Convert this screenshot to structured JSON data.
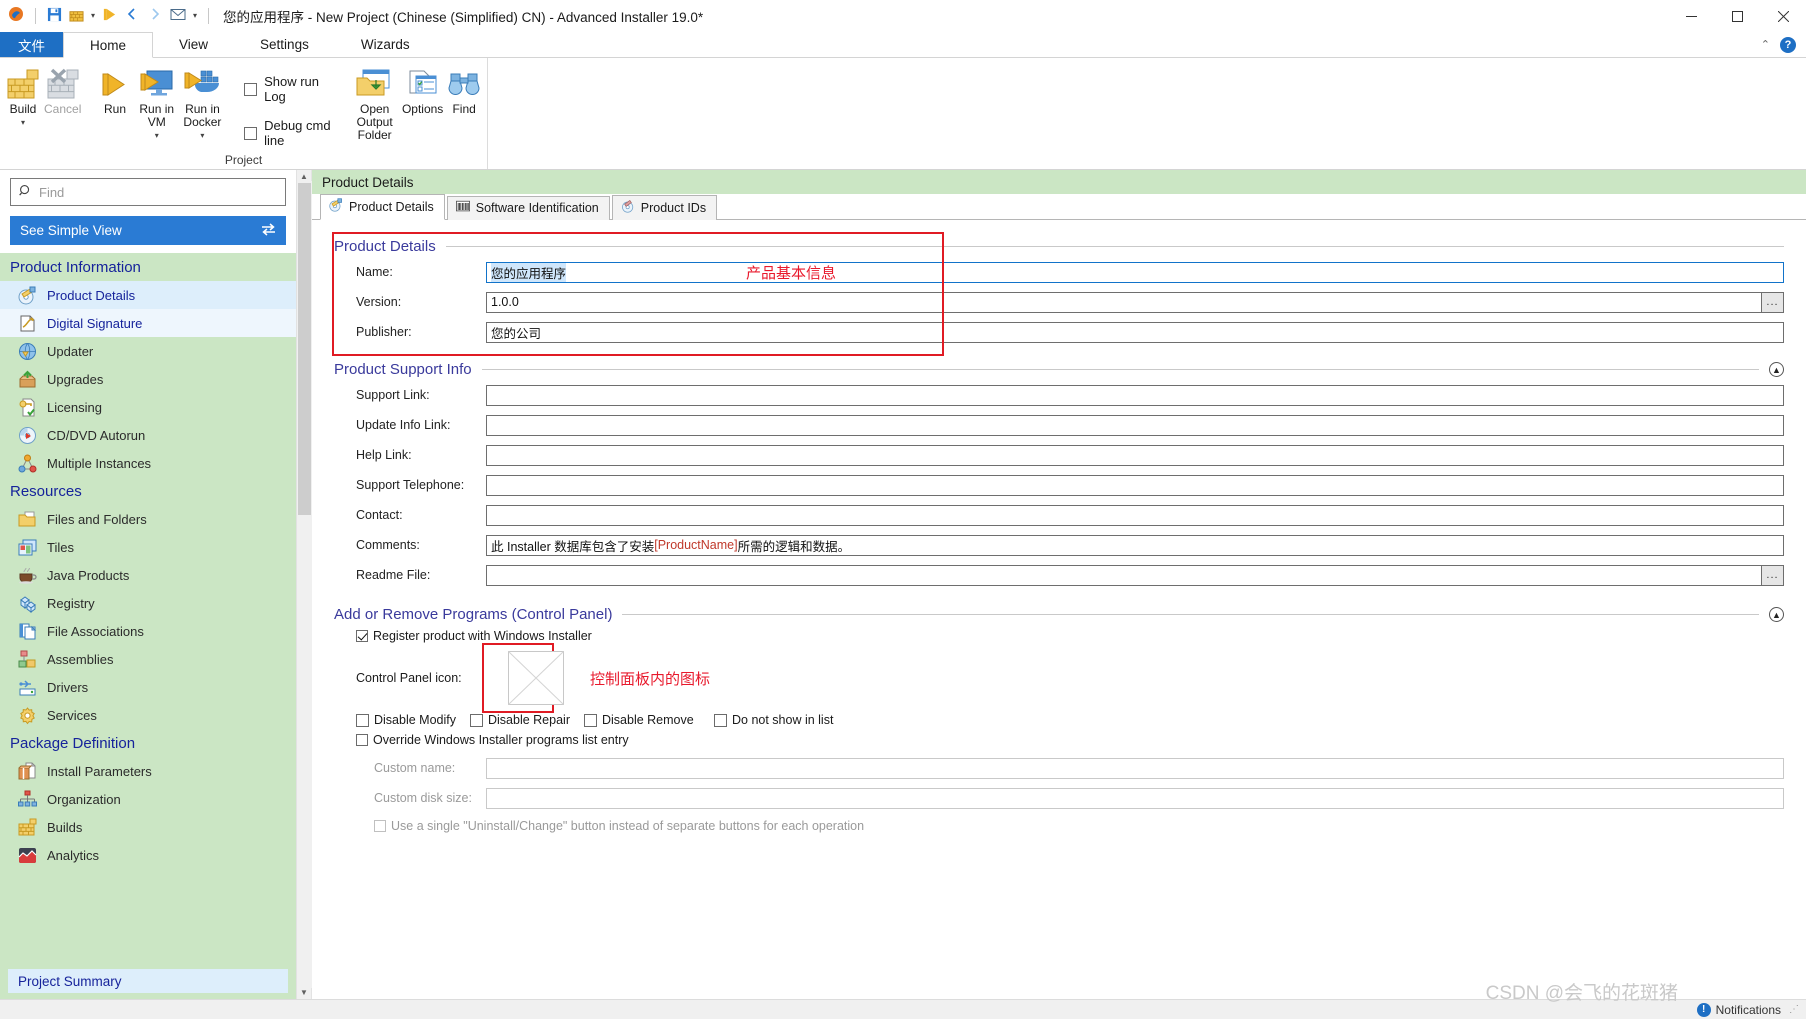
{
  "window": {
    "title": "您的应用程序 - New Project (Chinese (Simplified) CN) - Advanced Installer 19.0*",
    "minimize": "—",
    "maximize": "☐",
    "close": "✕",
    "quick_access": [
      "app-icon",
      "save-icon",
      "build-icon",
      "run-icon",
      "back-icon",
      "forward-icon",
      "mail-icon",
      "qat-dropdown-icon"
    ]
  },
  "ribbon": {
    "tabs": [
      {
        "label": "文件",
        "type": "file"
      },
      {
        "label": "Home",
        "type": "active"
      },
      {
        "label": "View",
        "type": "normal"
      },
      {
        "label": "Settings",
        "type": "normal"
      },
      {
        "label": "Wizards",
        "type": "normal"
      }
    ],
    "collapse_icon": "chevron-up-icon",
    "help_icon": "?",
    "group_label": "Project",
    "buttons": [
      {
        "label": "Build",
        "has_caret": true,
        "disabled": false
      },
      {
        "label": "Cancel",
        "has_caret": false,
        "disabled": true
      },
      {
        "label": "Run",
        "has_caret": false,
        "disabled": false
      },
      {
        "label": "Run in VM",
        "has_caret": true,
        "disabled": false
      },
      {
        "label": "Run in Docker",
        "has_caret": true,
        "disabled": false
      },
      {
        "label": "Open Output Folder",
        "has_caret": false,
        "disabled": false
      },
      {
        "label": "Options",
        "has_caret": false,
        "disabled": false
      },
      {
        "label": "Find",
        "has_caret": false,
        "disabled": false
      }
    ],
    "checkboxes": [
      {
        "label": "Show run Log",
        "checked": false
      },
      {
        "label": "Debug cmd line",
        "checked": false
      }
    ]
  },
  "sidebar": {
    "find_placeholder": "Find",
    "find_value": "",
    "simple_view_label": "See Simple View",
    "simple_view_icon": "swap-arrows-icon",
    "groups": [
      {
        "title": "Product Information",
        "items": [
          {
            "label": "Product Details",
            "icon": "product-details-icon",
            "state": "selected"
          },
          {
            "label": "Digital Signature",
            "icon": "digital-signature-icon",
            "state": "highlight"
          },
          {
            "label": "Updater",
            "icon": "updater-icon",
            "state": "normal"
          },
          {
            "label": "Upgrades",
            "icon": "upgrades-icon",
            "state": "normal"
          },
          {
            "label": "Licensing",
            "icon": "licensing-icon",
            "state": "normal"
          },
          {
            "label": "CD/DVD Autorun",
            "icon": "cd-dvd-icon",
            "state": "normal"
          },
          {
            "label": "Multiple Instances",
            "icon": "multiple-instances-icon",
            "state": "normal"
          }
        ]
      },
      {
        "title": "Resources",
        "items": [
          {
            "label": "Files and Folders",
            "icon": "folder-icon",
            "state": "normal"
          },
          {
            "label": "Tiles",
            "icon": "tiles-icon",
            "state": "normal"
          },
          {
            "label": "Java Products",
            "icon": "java-cup-icon",
            "state": "normal"
          },
          {
            "label": "Registry",
            "icon": "registry-icon",
            "state": "normal"
          },
          {
            "label": "File Associations",
            "icon": "file-associations-icon",
            "state": "normal"
          },
          {
            "label": "Assemblies",
            "icon": "assemblies-icon",
            "state": "normal"
          },
          {
            "label": "Drivers",
            "icon": "drivers-icon",
            "state": "normal"
          },
          {
            "label": "Services",
            "icon": "services-gear-icon",
            "state": "normal"
          }
        ]
      },
      {
        "title": "Package Definition",
        "items": [
          {
            "label": "Install Parameters",
            "icon": "install-parameters-icon",
            "state": "normal"
          },
          {
            "label": "Organization",
            "icon": "organization-icon",
            "state": "normal"
          },
          {
            "label": "Builds",
            "icon": "builds-icon",
            "state": "normal"
          },
          {
            "label": "Analytics",
            "icon": "analytics-icon",
            "state": "normal"
          }
        ]
      }
    ],
    "project_summary": "Project Summary"
  },
  "panel": {
    "header": "Product Details",
    "tabs": [
      {
        "label": "Product Details",
        "icon": "product-details-icon",
        "active": true
      },
      {
        "label": "Software Identification",
        "icon": "barcode-icon",
        "active": false
      },
      {
        "label": "Product IDs",
        "icon": "product-ids-icon",
        "active": false
      }
    ]
  },
  "product_details": {
    "section_title": "Product Details",
    "annotation": "产品基本信息",
    "fields": [
      {
        "label": "Name:",
        "value": "您的应用程序",
        "selected": true,
        "browse": false,
        "focused": true
      },
      {
        "label": "Version:",
        "value": "1.0.0",
        "selected": false,
        "browse": true,
        "focused": false
      },
      {
        "label": "Publisher:",
        "value": "您的公司",
        "selected": false,
        "browse": false,
        "focused": false
      }
    ]
  },
  "support_info": {
    "section_title": "Product Support Info",
    "collapse_icon": "chevron-up-circle-icon",
    "fields": [
      {
        "label": "Support Link:",
        "value": "",
        "browse": false
      },
      {
        "label": "Update Info Link:",
        "value": "",
        "browse": false
      },
      {
        "label": "Help Link:",
        "value": "",
        "browse": false
      },
      {
        "label": "Support Telephone:",
        "value": "",
        "browse": false
      },
      {
        "label": "Contact:",
        "value": "",
        "browse": false
      },
      {
        "label": "Comments:",
        "value_prefix": "此 Installer 数据库包含了安装 ",
        "value_token": "[ProductName]",
        "value_suffix": " 所需的逻辑和数据。",
        "browse": false
      },
      {
        "label": "Readme File:",
        "value": "",
        "browse": true
      }
    ]
  },
  "arp": {
    "section_title": "Add or Remove Programs (Control Panel)",
    "collapse_icon": "chevron-up-circle-icon",
    "register_checkbox": {
      "label": "Register product with Windows Installer",
      "checked": true
    },
    "control_panel_icon_label": "Control Panel icon:",
    "control_panel_icon_annotation": "控制面板内的图标",
    "disable_checkboxes": [
      {
        "label": "Disable Modify",
        "checked": false
      },
      {
        "label": "Disable Repair",
        "checked": false
      },
      {
        "label": "Disable Remove",
        "checked": false
      },
      {
        "label": "Do not show in list",
        "checked": false
      }
    ],
    "override_checkbox": {
      "label": "Override Windows Installer programs list entry",
      "checked": false
    },
    "custom_name_label": "Custom name:",
    "custom_name_value": "",
    "custom_disk_size_label": "Custom disk size:",
    "custom_disk_size_value": "",
    "single_button_checkbox": {
      "label": "Use a single \"Uninstall/Change\" button instead of separate buttons for each operation",
      "checked": false
    }
  },
  "statusbar": {
    "notifications": "Notifications",
    "notification_icon": "info-icon",
    "grip": "⋰"
  },
  "watermark": "CSDN @会飞的花斑猪",
  "colors": {
    "accent_blue": "#1e6fc4",
    "sidebar_green": "#cbe6c4",
    "section_title": "#3a3a9c",
    "annotation_red": "#e8192c",
    "redbox": "#e01b24"
  }
}
